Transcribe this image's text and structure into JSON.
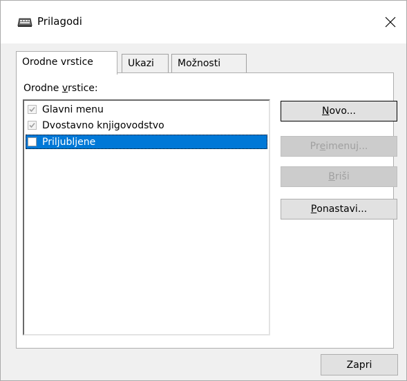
{
  "window": {
    "title": "Prilagodi",
    "icon": "keyboard-icon"
  },
  "tabs": [
    {
      "label": "Orodne vrstice",
      "active": true
    },
    {
      "label": "Ukazi",
      "active": false
    },
    {
      "label": "Možnosti",
      "active": false
    }
  ],
  "toolbars_panel": {
    "label_before": "Orodne ",
    "label_accel": "v",
    "label_after": "rstice:",
    "items": [
      {
        "label": "Glavni menu",
        "checked": true,
        "disabled": true,
        "selected": false
      },
      {
        "label": "Dvostavno knjigovodstvo",
        "checked": true,
        "disabled": true,
        "selected": false
      },
      {
        "label": "Priljubljene",
        "checked": false,
        "disabled": false,
        "selected": true
      }
    ]
  },
  "buttons": {
    "new": {
      "accel": "N",
      "rest": "ovo..."
    },
    "rename": {
      "before": "Pr",
      "accel": "e",
      "after": "imenuj..."
    },
    "delete": {
      "accel": "B",
      "rest": "riši"
    },
    "reset": {
      "accel": "P",
      "rest": "onastavi..."
    },
    "close": "Zapri"
  },
  "colors": {
    "selection": "#0078d7",
    "dialog_bg": "#f0f0f0",
    "button_bg": "#e1e1e1"
  }
}
